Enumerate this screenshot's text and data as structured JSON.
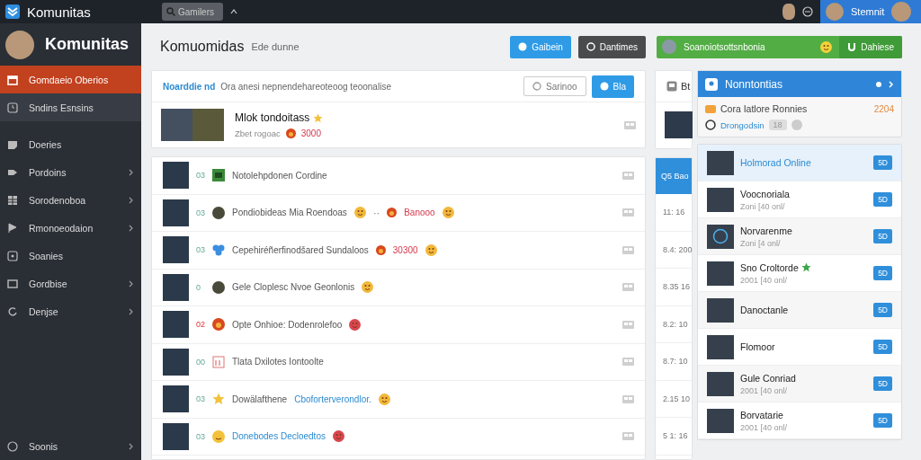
{
  "topbar": {
    "logo_text": "Komunitas",
    "search": {
      "placeholder": "Gamilers"
    },
    "user": {
      "name": "Stemnit"
    }
  },
  "sidebar": {
    "title": "Komunitas",
    "items": [
      {
        "label": "Gomdaeio Oberios",
        "selected": true,
        "submenu": false
      },
      {
        "label": "Sndins Esnsins",
        "selected": false,
        "submenu": false
      },
      {
        "label": "Doeries",
        "selected": false,
        "submenu": false
      },
      {
        "label": "Pordoins",
        "selected": false,
        "submenu": true
      },
      {
        "label": "Sorodenoboa",
        "selected": false,
        "submenu": true
      },
      {
        "label": "Rmonoeodaion",
        "selected": false,
        "submenu": true
      },
      {
        "label": "Soanies",
        "selected": false,
        "submenu": false
      },
      {
        "label": "Gordbise",
        "selected": false,
        "submenu": true
      },
      {
        "label": "Denjse",
        "selected": false,
        "submenu": true
      }
    ],
    "footer": {
      "label": "Soonis",
      "submenu": true
    }
  },
  "header": {
    "title": "Komuomidas",
    "subtitle": "Ede dunne",
    "buttons": [
      {
        "label": "Gaibein",
        "kind": "primary"
      },
      {
        "label": "Dantimes",
        "kind": "dark"
      }
    ],
    "banner": {
      "text": "Soanoiotsottsnbonia",
      "button": "Dahiese"
    }
  },
  "feed": {
    "highlight": "Noarddie nd",
    "text": "Ora anesi nepnendehareoteoog teoonalise",
    "buttons": [
      {
        "label": "Sarinoo",
        "kind": "outline"
      },
      {
        "label": "Bla",
        "kind": "primary"
      }
    ],
    "featured": {
      "title": "Mlok tondoitass",
      "meta": "Zbet rogoac",
      "score": "3000"
    },
    "rows": [
      {
        "tag": "03",
        "text": "Notolehpdonen Cordine",
        "tag_alert": false
      },
      {
        "tag": "03",
        "text": "Pondiobideas Mia Roendoas",
        "dots": "··",
        "score": "Banooo",
        "emoji": {
          "color": "#f2b83a"
        },
        "tag_alert": false
      },
      {
        "tag": "03",
        "text": "Cepehiréñerfinodšared Sundaloos",
        "score": "30300",
        "emoji": {
          "color": "#f2b83a"
        },
        "tag_alert": false
      },
      {
        "tag": "0",
        "text": "Gele Cloplesc Nvoe Geonlonis",
        "emoji": {
          "color": "#f2b83a"
        },
        "tag_alert": false
      },
      {
        "tag": "02",
        "text": "Opte Onhioe: Dodenrolefoo",
        "emoji": {
          "color": "#d9454f"
        },
        "tag_alert": true
      },
      {
        "tag": "00",
        "text": "Tlata Dxilotes Iontoolte",
        "tag_alert": false
      },
      {
        "tag": "03",
        "text": "Dowälafthene",
        "link": "Cboforterverondlor.",
        "emoji": {
          "color": "#f2b83a"
        },
        "tag_alert": false
      },
      {
        "tag": "03",
        "link": "Donebodes Decloedtos",
        "emoji": {
          "color": "#d9454f"
        },
        "tag_alert": false
      }
    ]
  },
  "middle": {
    "title": "Bt",
    "header": "Q5 Bao",
    "rows": [
      "11: 16",
      "8.4: 200",
      "8.35 16",
      "8.2: 10",
      "8.7: 10",
      "2.15 10",
      "5 1: 16"
    ]
  },
  "panel": {
    "title": "Nonntontias",
    "info": {
      "label": "Cora Iatlore Ronnies",
      "value": "2204",
      "link": "Drongodsin",
      "count": "18"
    },
    "items": [
      {
        "name": "Holmorad Online",
        "selected": true,
        "star": false,
        "badge": "5D",
        "kind": "photo"
      },
      {
        "name": "Voocnoriala",
        "sub": "Zoni [40 onl/",
        "selected": false,
        "star": false,
        "badge": "5D",
        "kind": "photo"
      },
      {
        "name": "Norvarenme",
        "sub": "Zoni [4 onl/",
        "selected": false,
        "star": false,
        "badge": "5D",
        "kind": "ring"
      },
      {
        "name": "Sno Croltorde",
        "sub": "2001 [40 onl/",
        "selected": false,
        "star": true,
        "badge": "5D",
        "kind": "photo"
      },
      {
        "name": "Danoctanle",
        "selected": false,
        "star": false,
        "badge": "5D",
        "kind": "photo"
      },
      {
        "name": "Flomoor",
        "selected": false,
        "star": false,
        "badge": "5D",
        "kind": "photo"
      },
      {
        "name": "Gule Conriad",
        "sub": "2001 [40 onl/",
        "selected": false,
        "star": false,
        "badge": "5D",
        "kind": "photo"
      },
      {
        "name": "Borvatarie",
        "sub": "2001 [40 onl/",
        "selected": false,
        "star": false,
        "badge": "5D",
        "kind": "photo"
      }
    ]
  }
}
